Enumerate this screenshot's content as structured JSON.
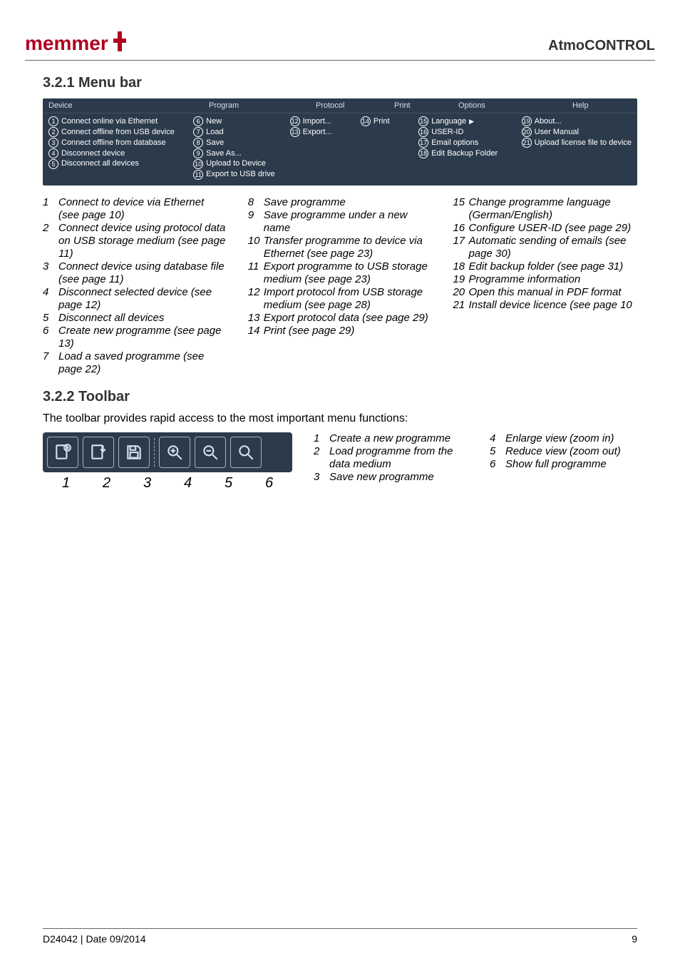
{
  "header": {
    "product_name": "AtmoCONTROL",
    "logo_text": "memmert"
  },
  "section_menu": {
    "title": "3.2.1  Menu bar"
  },
  "menubar": {
    "device": {
      "label": "Device",
      "items": [
        "Connect online via Ethernet",
        "Connect offline from USB device",
        "Connect offline from database",
        "Disconnect device",
        "Disconnect all devices"
      ]
    },
    "program": {
      "label": "Program",
      "items": [
        "New",
        "Load",
        "Save",
        "Save As...",
        "Upload to Device",
        "Export to USB drive"
      ]
    },
    "protocol": {
      "label": "Protocol",
      "items": [
        "Import...",
        "Export..."
      ]
    },
    "print": {
      "label": "Print",
      "items": [
        "Print"
      ]
    },
    "options": {
      "label": "Options",
      "items": [
        "Language",
        "USER-ID",
        "Email options",
        "Edit Backup Folder"
      ]
    },
    "help": {
      "label": "Help",
      "items": [
        "About...",
        "User Manual",
        "Upload license file to device"
      ]
    }
  },
  "menu_legend": {
    "col1": [
      {
        "n": "1",
        "t": "Connect to device via Ethernet (see page 10)"
      },
      {
        "n": "2",
        "t": "Connect device using protocol data on USB storage medium (see page 11)"
      },
      {
        "n": "3",
        "t": "Connect device using database file (see page 11)"
      },
      {
        "n": "4",
        "t": "Disconnect selected device (see page 12)"
      },
      {
        "n": "5",
        "t": "Disconnect all devices"
      },
      {
        "n": "6",
        "t": "Create new programme (see page 13)"
      },
      {
        "n": "7",
        "t": "Load a saved programme (see page 22)"
      }
    ],
    "col2": [
      {
        "n": "8",
        "t": "Save programme"
      },
      {
        "n": "9",
        "t": "Save programme under a new name"
      },
      {
        "n": "10",
        "t": "Transfer programme to device via Ethernet (see page 23)"
      },
      {
        "n": "11",
        "t": "Export programme to USB storage medium (see page 23)"
      },
      {
        "n": "12",
        "t": "Import protocol from USB storage medium (see page 28)"
      },
      {
        "n": "13",
        "t": "Export protocol data (see page 29)"
      },
      {
        "n": "14",
        "t": "Print (see page 29)"
      }
    ],
    "col3": [
      {
        "n": "15",
        "t": "Change programme language (German/English)"
      },
      {
        "n": "16",
        "t": "Configure USER-ID (see page 29)"
      },
      {
        "n": "17",
        "t": "Automatic sending of emails (see page 30)"
      },
      {
        "n": "18",
        "t": "Edit backup folder (see page 31)"
      },
      {
        "n": "19",
        "t": "Programme information"
      },
      {
        "n": "20",
        "t": "Open this manual in PDF format"
      },
      {
        "n": "21",
        "t": "Install device licence (see page 10"
      }
    ]
  },
  "section_toolbar": {
    "title": "3.2.2  Toolbar",
    "intro": "The toolbar provides rapid access to the most important menu functions:"
  },
  "toolbar": {
    "numbers": [
      "1",
      "2",
      "3",
      "4",
      "5",
      "6"
    ]
  },
  "toolbar_legend": {
    "col1": [
      {
        "n": "1",
        "t": "Create a new programme"
      },
      {
        "n": "2",
        "t": "Load programme from the data medium"
      },
      {
        "n": "3",
        "t": "Save new programme"
      }
    ],
    "col2": [
      {
        "n": "4",
        "t": "Enlarge view (zoom in)"
      },
      {
        "n": "5",
        "t": "Reduce view (zoom out)"
      },
      {
        "n": "6",
        "t": "Show full programme"
      }
    ]
  },
  "footer": {
    "left": "D24042 | Date 09/2014",
    "right": "9"
  }
}
